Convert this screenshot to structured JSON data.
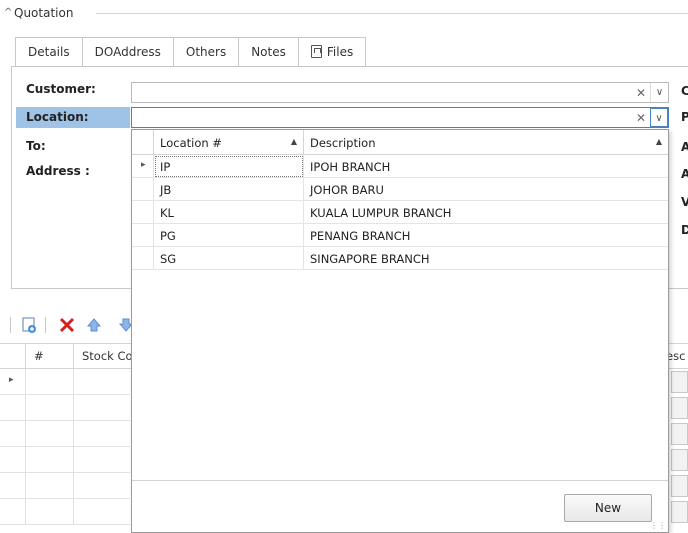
{
  "group": {
    "title": "Quotation"
  },
  "tabs": [
    {
      "label": "Details"
    },
    {
      "label": "DOAddress"
    },
    {
      "label": "Others"
    },
    {
      "label": "Notes"
    },
    {
      "label": "Files",
      "icon": "file-icon"
    }
  ],
  "form": {
    "customer_label": "Customer:",
    "location_label": "Location:",
    "to_label": "To:",
    "address_label": "Address :",
    "right_labels": [
      "C",
      "P",
      "A",
      "A",
      "V",
      "D"
    ]
  },
  "lookup": {
    "columns": [
      {
        "label": "Location #",
        "sort": "ascending"
      },
      {
        "label": "Description",
        "sort": "ascending"
      }
    ],
    "rows": [
      {
        "code": "IP",
        "description": "IPOH BRANCH"
      },
      {
        "code": "JB",
        "description": "JOHOR BARU"
      },
      {
        "code": "KL",
        "description": "KUALA LUMPUR BRANCH"
      },
      {
        "code": "PG",
        "description": "PENANG BRANCH"
      },
      {
        "code": "SG",
        "description": "SINGAPORE BRANCH"
      }
    ],
    "new_button": "New"
  },
  "detail_grid": {
    "columns": [
      "#",
      "Stock Co"
    ],
    "right_header": "esc"
  },
  "colors": {
    "selected_label_bg": "#9ec3e6",
    "focus_border": "#4a7fc1",
    "delete_red": "#d32020",
    "arrow_blue": "#5b8fd6"
  }
}
